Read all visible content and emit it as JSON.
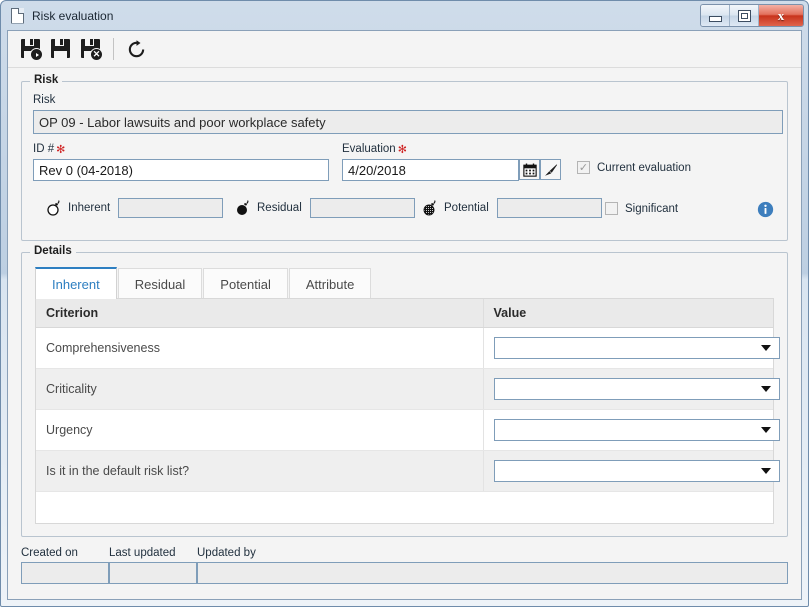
{
  "window": {
    "title": "Risk evaluation",
    "doc_icon": "document-icon",
    "minimize_label": "Minimize",
    "maximize_label": "Maximize",
    "close_label": "Close"
  },
  "toolbar": {
    "buttons": [
      {
        "name": "save-and-new",
        "icon": "save-new-icon",
        "label": "Save and new"
      },
      {
        "name": "save",
        "icon": "save-icon",
        "label": "Save"
      },
      {
        "name": "save-and-close",
        "icon": "save-close-icon",
        "label": "Save and close"
      },
      {
        "name": "refresh",
        "icon": "refresh-icon",
        "label": "Refresh"
      }
    ]
  },
  "risk_group": {
    "legend": "Risk",
    "risk_label": "Risk",
    "risk_value": "OP 09 - Labor lawsuits and poor workplace safety",
    "id_label": "ID #",
    "id_required": "✻",
    "id_value": "Rev 0 (04-2018)",
    "evaluation_label": "Evaluation",
    "evaluation_required": "✻",
    "evaluation_value": "4/20/2018",
    "calendar_icon": "calendar-icon",
    "clear_icon": "brush-icon",
    "current_evaluation_label": "Current evaluation",
    "current_evaluation_checked": true,
    "metrics": [
      {
        "name": "inherent",
        "icon": "bomb-outline-icon",
        "label": "Inherent",
        "value": ""
      },
      {
        "name": "residual",
        "icon": "bomb-filled-icon",
        "label": "Residual",
        "value": ""
      },
      {
        "name": "potential",
        "icon": "bomb-hatched-icon",
        "label": "Potential",
        "value": ""
      }
    ],
    "significant_label": "Significant",
    "significant_checked": false,
    "info_icon": "info-icon"
  },
  "details_group": {
    "legend": "Details",
    "tabs": [
      {
        "label": "Inherent",
        "active": true
      },
      {
        "label": "Residual",
        "active": false
      },
      {
        "label": "Potential",
        "active": false
      },
      {
        "label": "Attribute",
        "active": false
      }
    ],
    "columns": [
      "Criterion",
      "Value"
    ],
    "rows": [
      {
        "criterion": "Comprehensiveness",
        "value": ""
      },
      {
        "criterion": "Criticality",
        "value": ""
      },
      {
        "criterion": "Urgency",
        "value": ""
      },
      {
        "criterion": "Is it in the default risk list?",
        "value": ""
      }
    ]
  },
  "footer": {
    "created_on_label": "Created on",
    "created_on_value": "",
    "last_updated_label": "Last updated",
    "last_updated_value": "",
    "updated_by_label": "Updated by",
    "updated_by_value": ""
  },
  "colors": {
    "accent": "#2e7fc1",
    "required": "#cf2222",
    "close_button": "#c8331c",
    "info": "#3d7ebd",
    "field_border": "#7f9db9"
  }
}
